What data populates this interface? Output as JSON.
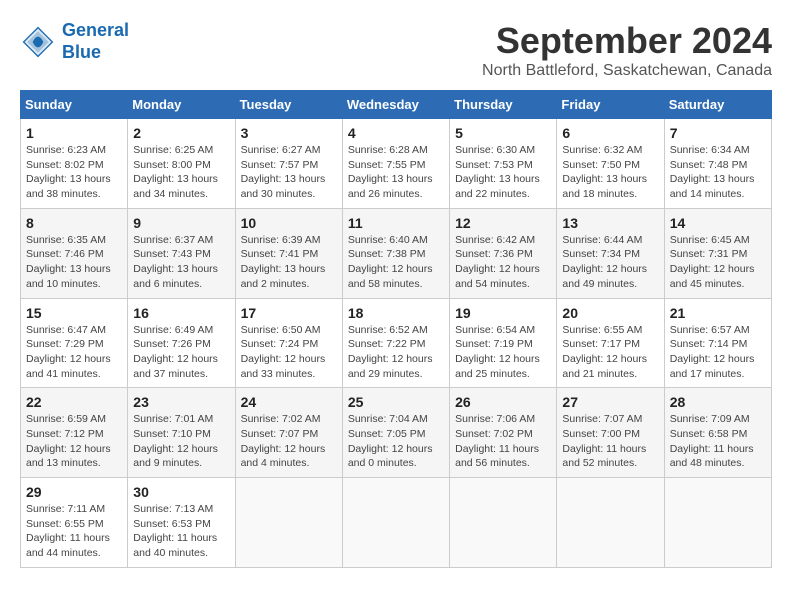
{
  "logo": {
    "line1": "General",
    "line2": "Blue"
  },
  "title": "September 2024",
  "subtitle": "North Battleford, Saskatchewan, Canada",
  "days_of_week": [
    "Sunday",
    "Monday",
    "Tuesday",
    "Wednesday",
    "Thursday",
    "Friday",
    "Saturday"
  ],
  "weeks": [
    [
      {
        "day": "1",
        "info": "Sunrise: 6:23 AM\nSunset: 8:02 PM\nDaylight: 13 hours\nand 38 minutes."
      },
      {
        "day": "2",
        "info": "Sunrise: 6:25 AM\nSunset: 8:00 PM\nDaylight: 13 hours\nand 34 minutes."
      },
      {
        "day": "3",
        "info": "Sunrise: 6:27 AM\nSunset: 7:57 PM\nDaylight: 13 hours\nand 30 minutes."
      },
      {
        "day": "4",
        "info": "Sunrise: 6:28 AM\nSunset: 7:55 PM\nDaylight: 13 hours\nand 26 minutes."
      },
      {
        "day": "5",
        "info": "Sunrise: 6:30 AM\nSunset: 7:53 PM\nDaylight: 13 hours\nand 22 minutes."
      },
      {
        "day": "6",
        "info": "Sunrise: 6:32 AM\nSunset: 7:50 PM\nDaylight: 13 hours\nand 18 minutes."
      },
      {
        "day": "7",
        "info": "Sunrise: 6:34 AM\nSunset: 7:48 PM\nDaylight: 13 hours\nand 14 minutes."
      }
    ],
    [
      {
        "day": "8",
        "info": "Sunrise: 6:35 AM\nSunset: 7:46 PM\nDaylight: 13 hours\nand 10 minutes."
      },
      {
        "day": "9",
        "info": "Sunrise: 6:37 AM\nSunset: 7:43 PM\nDaylight: 13 hours\nand 6 minutes."
      },
      {
        "day": "10",
        "info": "Sunrise: 6:39 AM\nSunset: 7:41 PM\nDaylight: 13 hours\nand 2 minutes."
      },
      {
        "day": "11",
        "info": "Sunrise: 6:40 AM\nSunset: 7:38 PM\nDaylight: 12 hours\nand 58 minutes."
      },
      {
        "day": "12",
        "info": "Sunrise: 6:42 AM\nSunset: 7:36 PM\nDaylight: 12 hours\nand 54 minutes."
      },
      {
        "day": "13",
        "info": "Sunrise: 6:44 AM\nSunset: 7:34 PM\nDaylight: 12 hours\nand 49 minutes."
      },
      {
        "day": "14",
        "info": "Sunrise: 6:45 AM\nSunset: 7:31 PM\nDaylight: 12 hours\nand 45 minutes."
      }
    ],
    [
      {
        "day": "15",
        "info": "Sunrise: 6:47 AM\nSunset: 7:29 PM\nDaylight: 12 hours\nand 41 minutes."
      },
      {
        "day": "16",
        "info": "Sunrise: 6:49 AM\nSunset: 7:26 PM\nDaylight: 12 hours\nand 37 minutes."
      },
      {
        "day": "17",
        "info": "Sunrise: 6:50 AM\nSunset: 7:24 PM\nDaylight: 12 hours\nand 33 minutes."
      },
      {
        "day": "18",
        "info": "Sunrise: 6:52 AM\nSunset: 7:22 PM\nDaylight: 12 hours\nand 29 minutes."
      },
      {
        "day": "19",
        "info": "Sunrise: 6:54 AM\nSunset: 7:19 PM\nDaylight: 12 hours\nand 25 minutes."
      },
      {
        "day": "20",
        "info": "Sunrise: 6:55 AM\nSunset: 7:17 PM\nDaylight: 12 hours\nand 21 minutes."
      },
      {
        "day": "21",
        "info": "Sunrise: 6:57 AM\nSunset: 7:14 PM\nDaylight: 12 hours\nand 17 minutes."
      }
    ],
    [
      {
        "day": "22",
        "info": "Sunrise: 6:59 AM\nSunset: 7:12 PM\nDaylight: 12 hours\nand 13 minutes."
      },
      {
        "day": "23",
        "info": "Sunrise: 7:01 AM\nSunset: 7:10 PM\nDaylight: 12 hours\nand 9 minutes."
      },
      {
        "day": "24",
        "info": "Sunrise: 7:02 AM\nSunset: 7:07 PM\nDaylight: 12 hours\nand 4 minutes."
      },
      {
        "day": "25",
        "info": "Sunrise: 7:04 AM\nSunset: 7:05 PM\nDaylight: 12 hours\nand 0 minutes."
      },
      {
        "day": "26",
        "info": "Sunrise: 7:06 AM\nSunset: 7:02 PM\nDaylight: 11 hours\nand 56 minutes."
      },
      {
        "day": "27",
        "info": "Sunrise: 7:07 AM\nSunset: 7:00 PM\nDaylight: 11 hours\nand 52 minutes."
      },
      {
        "day": "28",
        "info": "Sunrise: 7:09 AM\nSunset: 6:58 PM\nDaylight: 11 hours\nand 48 minutes."
      }
    ],
    [
      {
        "day": "29",
        "info": "Sunrise: 7:11 AM\nSunset: 6:55 PM\nDaylight: 11 hours\nand 44 minutes."
      },
      {
        "day": "30",
        "info": "Sunrise: 7:13 AM\nSunset: 6:53 PM\nDaylight: 11 hours\nand 40 minutes."
      },
      {
        "day": "",
        "info": ""
      },
      {
        "day": "",
        "info": ""
      },
      {
        "day": "",
        "info": ""
      },
      {
        "day": "",
        "info": ""
      },
      {
        "day": "",
        "info": ""
      }
    ]
  ]
}
